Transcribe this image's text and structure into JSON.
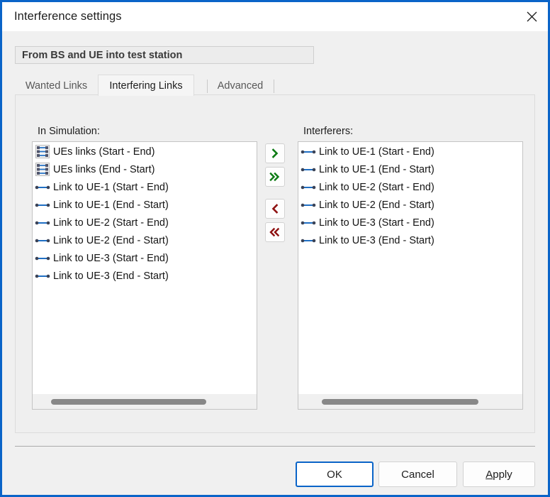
{
  "window": {
    "title": "Interference settings",
    "frame_color": "#0a64c8",
    "close_icon": "close-icon"
  },
  "group_header": {
    "text": "From BS and UE into test station"
  },
  "tabs": [
    {
      "label": "Wanted Links",
      "selected": false
    },
    {
      "label": "Interfering Links",
      "selected": true
    },
    {
      "label": "Advanced",
      "selected": false
    }
  ],
  "panes": {
    "left": {
      "label": "In Simulation:",
      "items": [
        {
          "label": "UEs links (Start - End)",
          "icon": "link-group-icon"
        },
        {
          "label": "UEs links (End - Start)",
          "icon": "link-group-icon"
        },
        {
          "label": "Link to UE-1 (Start - End)",
          "icon": "link-icon"
        },
        {
          "label": "Link to UE-1 (End - Start)",
          "icon": "link-icon"
        },
        {
          "label": "Link to UE-2 (Start - End)",
          "icon": "link-icon"
        },
        {
          "label": "Link to UE-2 (End - Start)",
          "icon": "link-icon"
        },
        {
          "label": "Link to UE-3 (Start - End)",
          "icon": "link-icon"
        },
        {
          "label": "Link to UE-3 (End - Start)",
          "icon": "link-icon"
        }
      ],
      "scrollbar": {
        "orientation": "horizontal"
      }
    },
    "right": {
      "label": "Interferers:",
      "items": [
        {
          "label": "Link to UE-1 (Start - End)",
          "icon": "link-icon"
        },
        {
          "label": "Link to UE-1 (End - Start)",
          "icon": "link-icon"
        },
        {
          "label": "Link to UE-2 (Start - End)",
          "icon": "link-icon"
        },
        {
          "label": "Link to UE-2 (End - Start)",
          "icon": "link-icon"
        },
        {
          "label": "Link to UE-3 (Start - End)",
          "icon": "link-icon"
        },
        {
          "label": "Link to UE-3 (End - Start)",
          "icon": "link-icon"
        }
      ],
      "scrollbar": {
        "orientation": "horizontal"
      }
    }
  },
  "transfer_buttons": [
    {
      "icon": "chevron-right-icon",
      "color": "#0b7a12"
    },
    {
      "icon": "chevron-double-right-icon",
      "color": "#0b7a12"
    },
    {
      "icon": "chevron-left-icon",
      "color": "#8e1111"
    },
    {
      "icon": "chevron-double-left-icon",
      "color": "#8e1111"
    }
  ],
  "dialog_buttons": {
    "ok": "OK",
    "cancel": "Cancel",
    "apply_accel": "A",
    "apply_rest": "pply"
  },
  "colors": {
    "accent": "#0a64c8",
    "link_icon": "#1f6fc4",
    "add_arrow": "#0b7a12",
    "remove_arrow": "#8e1111",
    "scroll_thumb": "#888888"
  }
}
